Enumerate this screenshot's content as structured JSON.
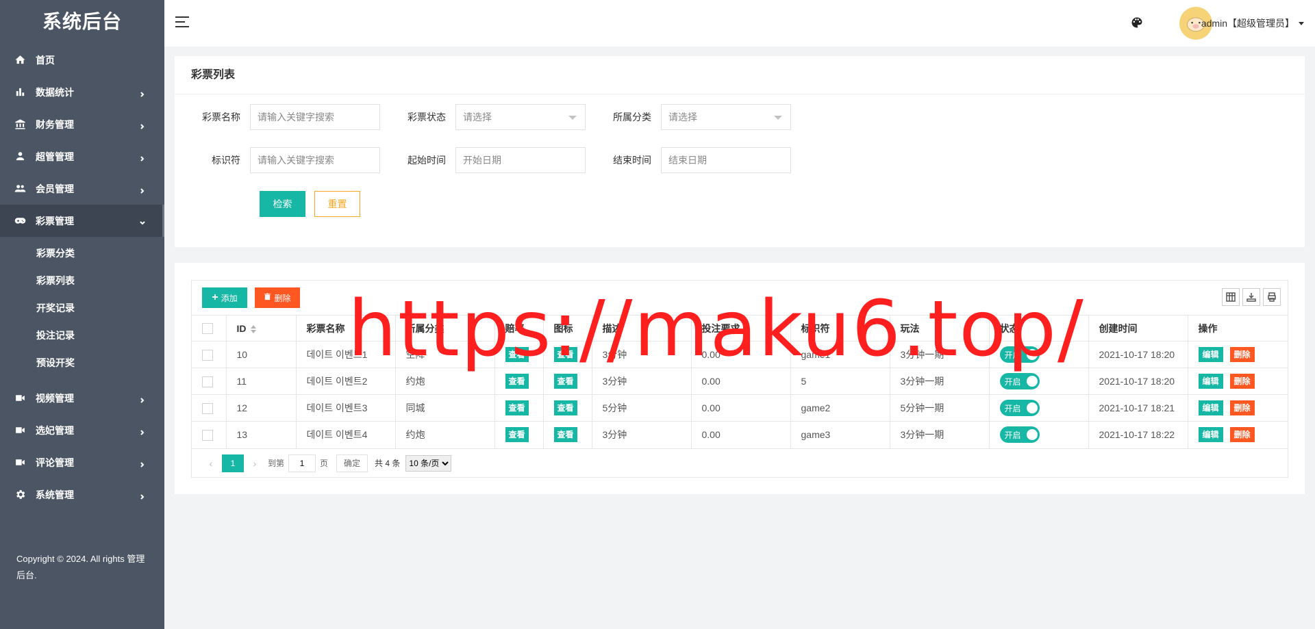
{
  "sidebar": {
    "brand": "系统后台",
    "items": [
      {
        "label": "首页"
      },
      {
        "label": "数据统计"
      },
      {
        "label": "财务管理"
      },
      {
        "label": "超管管理"
      },
      {
        "label": "会员管理"
      },
      {
        "label": "彩票管理"
      },
      {
        "label": "视频管理"
      },
      {
        "label": "选妃管理"
      },
      {
        "label": "评论管理"
      },
      {
        "label": "系统管理"
      }
    ],
    "submenu": [
      "彩票分类",
      "彩票列表",
      "开奖记录",
      "投注记录",
      "预设开奖"
    ],
    "copyright": "Copyright © 2024. All rights 管理后台."
  },
  "header": {
    "user": "admin【超级管理员】"
  },
  "search": {
    "title": "彩票列表",
    "labels": {
      "name": "彩票名称",
      "status": "彩票状态",
      "category": "所属分类",
      "identifier": "标识符",
      "start": "起始时间",
      "end": "结束时间"
    },
    "placeholders": {
      "name": "请输入关键字搜索",
      "status": "请选择",
      "category": "请选择",
      "identifier": "请输入关键字搜索",
      "start": "开始日期",
      "end": "结束日期"
    },
    "search_btn": "检索",
    "reset_btn": "重置"
  },
  "table": {
    "add_btn": "添加",
    "delete_btn": "删除",
    "columns": [
      "ID",
      "彩票名称",
      "所属分类",
      "赔率",
      "图标",
      "描述",
      "投注要求",
      "标识符",
      "玩法",
      "状态",
      "创建时间",
      "操作"
    ],
    "view_label": "查看",
    "switch_label": "开启",
    "edit_label": "编辑",
    "row_delete_label": "删除",
    "rows": [
      {
        "id": "10",
        "name": "데이트 이벤트1",
        "category": "空降",
        "desc": "3分钟",
        "req": "0.00",
        "ident": "game1",
        "play": "3分钟一期",
        "created": "2021-10-17 18:20"
      },
      {
        "id": "11",
        "name": "데이트 이벤트2",
        "category": "约炮",
        "desc": "3分钟",
        "req": "0.00",
        "ident": "5",
        "play": "3分钟一期",
        "created": "2021-10-17 18:20"
      },
      {
        "id": "12",
        "name": "데이트 이벤트3",
        "category": "同城",
        "desc": "5分钟",
        "req": "0.00",
        "ident": "game2",
        "play": "5分钟一期",
        "created": "2021-10-17 18:21"
      },
      {
        "id": "13",
        "name": "데이트 이벤트4",
        "category": "约炮",
        "desc": "3分钟",
        "req": "0.00",
        "ident": "game3",
        "play": "3分钟一期",
        "created": "2021-10-17 18:22"
      }
    ]
  },
  "pager": {
    "current": "1",
    "goto_label": "到第",
    "page_value": "1",
    "page_unit": "页",
    "confirm": "确定",
    "total": "共 4 条",
    "size_option": "10 条/页"
  },
  "watermark": "https://maku6.top/"
}
